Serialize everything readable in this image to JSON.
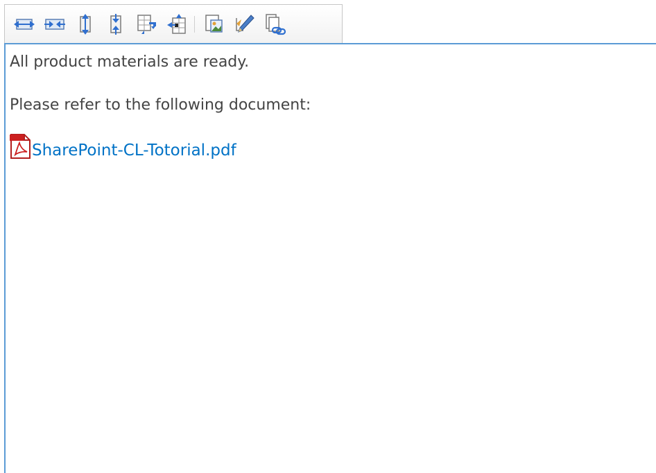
{
  "toolbar": {
    "buttons": [
      {
        "icon": "expand-horizontal-icon"
      },
      {
        "icon": "collapse-horizontal-icon"
      },
      {
        "icon": "expand-vertical-icon"
      },
      {
        "icon": "collapse-vertical-icon"
      },
      {
        "icon": "insert-row-below-icon"
      },
      {
        "icon": "insert-column-left-icon"
      },
      {
        "icon": "insert-image-icon"
      },
      {
        "icon": "edit-pen-icon"
      },
      {
        "icon": "attach-link-icon"
      }
    ]
  },
  "content": {
    "paragraph_1": "All product materials are ready.",
    "paragraph_2": "Please refer to the following document:",
    "attachment": {
      "name": "SharePoint-CL-Totorial.pdf",
      "icon": "pdf-file-icon"
    }
  },
  "colors": {
    "editor_border": "#5b9bd5",
    "link": "#0072c6",
    "text": "#444444",
    "pdf_red": "#cc1f1f"
  }
}
